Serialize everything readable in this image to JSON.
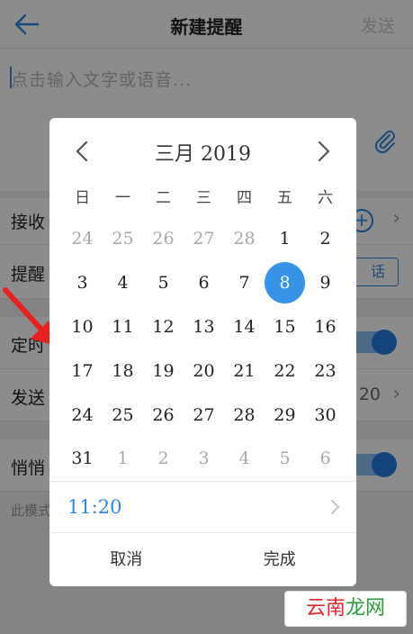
{
  "header": {
    "title": "新建提醒",
    "send_label": "发送"
  },
  "editor": {
    "placeholder": "点击输入文字或语音..."
  },
  "rows": {
    "receive_label": "接收",
    "reminder_label": "提醒",
    "chat_button": "话",
    "timer_label": "定时",
    "send_label": "发送",
    "send_value": "20",
    "quiet_label": "悄悄"
  },
  "hint": "此模式",
  "calendar": {
    "month_title": "三月 2019",
    "weekdays": [
      "日",
      "一",
      "二",
      "三",
      "四",
      "五",
      "六"
    ],
    "weeks": [
      [
        "24",
        "25",
        "26",
        "27",
        "28",
        "1",
        "2"
      ],
      [
        "3",
        "4",
        "5",
        "6",
        "7",
        "8",
        "9"
      ],
      [
        "10",
        "11",
        "12",
        "13",
        "14",
        "15",
        "16"
      ],
      [
        "17",
        "18",
        "19",
        "20",
        "21",
        "22",
        "23"
      ],
      [
        "24",
        "25",
        "26",
        "27",
        "28",
        "29",
        "30"
      ],
      [
        "31",
        "1",
        "2",
        "3",
        "4",
        "5",
        "6"
      ]
    ],
    "selected_day": "8",
    "time": "11:20",
    "cancel_label": "取消",
    "done_label": "完成"
  },
  "watermark": {
    "text_red": "云南",
    "text_green": "龙网"
  },
  "colors": {
    "accent": "#3793e8",
    "annotation": "#e8211e"
  },
  "icons": {
    "back": "arrow-left-icon",
    "attach": "paperclip-icon",
    "prev": "chevron-left-icon",
    "next": "chevron-right-icon"
  }
}
